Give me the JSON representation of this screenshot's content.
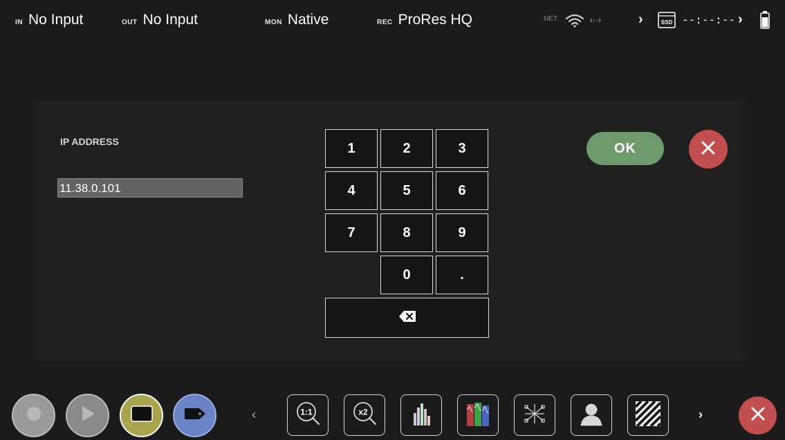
{
  "status": {
    "in": {
      "key": "IN",
      "value": "No Input"
    },
    "out": {
      "key": "OUT",
      "value": "No Input"
    },
    "mon": {
      "key": "MON",
      "value": "Native"
    },
    "rec": {
      "key": "REC",
      "value": "ProRes HQ"
    },
    "net_label": "NET",
    "net_arrows": "‹··›",
    "ssd_label": "SSD",
    "timecode": "--:--:--"
  },
  "dialog": {
    "ip_label": "IP ADDRESS",
    "ip_value": "11.38.0.101",
    "keys": [
      "1",
      "2",
      "3",
      "4",
      "5",
      "6",
      "7",
      "8",
      "9",
      "0",
      "."
    ],
    "ok_label": "OK"
  },
  "toolbar": {
    "zoom_1to1_label": "1:1",
    "zoom_x2_label": "x2",
    "colors": {
      "record": "#9a9a9a",
      "play": "#8a8a8a",
      "monitor": "#a9a54e",
      "tag": "#6a83c4",
      "close": "#c14f4f",
      "ok": "#6f9a6d"
    }
  },
  "icons": [
    "wifi-icon",
    "network-arrows-icon",
    "chevron-right-icon",
    "ssd-icon",
    "battery-icon",
    "backspace-icon",
    "close-icon",
    "record-icon",
    "play-icon",
    "monitor-icon",
    "tag-icon",
    "chevron-left-icon",
    "zoom-1to1-icon",
    "zoom-x2-icon",
    "histogram-icon",
    "waveform-icon",
    "vectorscope-icon",
    "false-color-icon",
    "zebra-icon"
  ]
}
